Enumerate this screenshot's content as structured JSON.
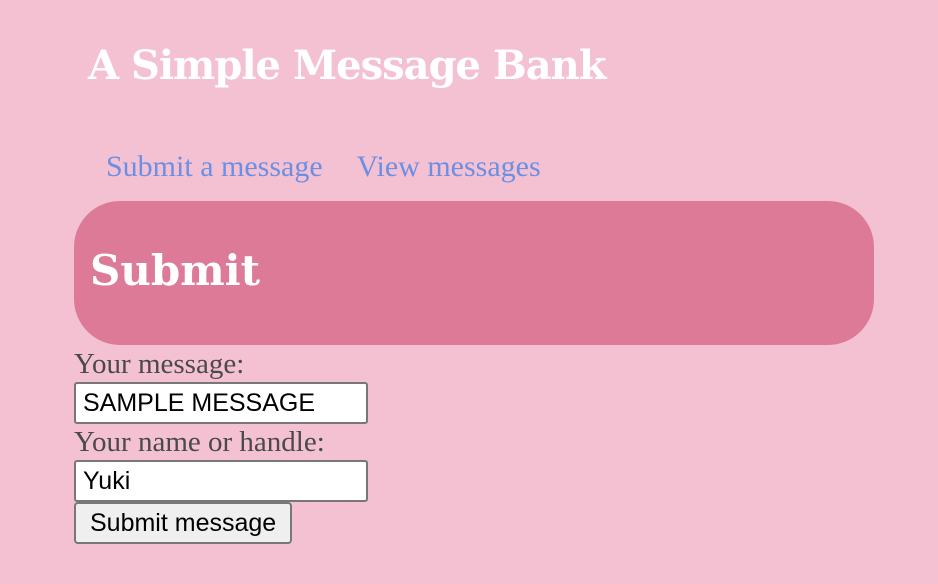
{
  "site": {
    "title": "A Simple Message Bank"
  },
  "nav": {
    "items": [
      {
        "label": "Submit a message"
      },
      {
        "label": "View messages"
      }
    ]
  },
  "section": {
    "title": "Submit"
  },
  "form": {
    "message_label": "Your message:",
    "message_value": "SAMPLE MESSAGE",
    "name_label": "Your name or handle:",
    "name_value": "Yuki",
    "submit_label": "Submit message"
  },
  "colors": {
    "page_background": "#f4c1d2",
    "banner_background": "#dc7a97",
    "link": "#6b8fe3",
    "title_text": "#ffffff",
    "label_text": "#4a4a4a"
  }
}
